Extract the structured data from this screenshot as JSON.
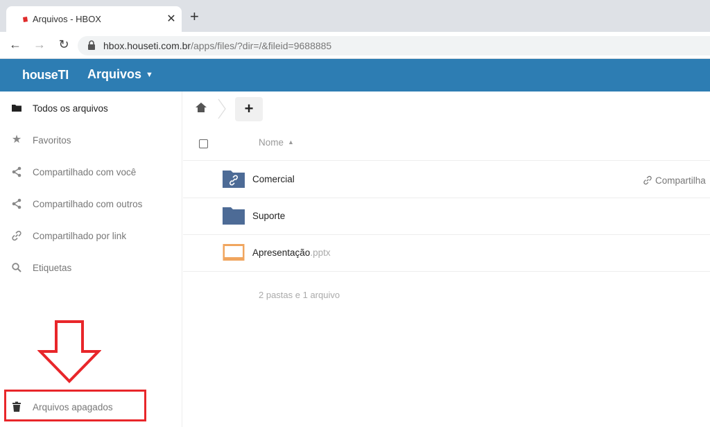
{
  "browser": {
    "tab_title": "Arquivos - HBOX",
    "tab_close": "✕",
    "new_tab": "+",
    "url_host": "hbox.houseti.com.br",
    "url_path": "/apps/files/?dir=/&fileid=9688885"
  },
  "header": {
    "brand": "houseTI",
    "app_menu_label": "Arquivos",
    "accent_color": "#2d7db3"
  },
  "sidebar": {
    "items": [
      {
        "label": "Todos os arquivos",
        "icon": "folder-icon",
        "active": true
      },
      {
        "label": "Favoritos",
        "icon": "star-icon"
      },
      {
        "label": "Compartilhado com você",
        "icon": "share-icon"
      },
      {
        "label": "Compartilhado com outros",
        "icon": "share-icon"
      },
      {
        "label": "Compartilhado por link",
        "icon": "link-icon"
      },
      {
        "label": "Etiquetas",
        "icon": "search-icon"
      }
    ],
    "trash": {
      "label": "Arquivos apagados",
      "icon": "trash-icon"
    }
  },
  "main": {
    "add_button": "+",
    "column_name": "Nome",
    "files": [
      {
        "name": "Comercial",
        "ext": "",
        "type": "shared-folder",
        "share_label": "Compartilha"
      },
      {
        "name": "Suporte",
        "ext": "",
        "type": "folder",
        "share_label": ""
      },
      {
        "name": "Apresentação",
        "ext": ".pptx",
        "type": "presentation",
        "share_label": ""
      }
    ],
    "summary": "2 pastas e 1 arquivo"
  },
  "annotation": {
    "color": "#e8262a"
  }
}
